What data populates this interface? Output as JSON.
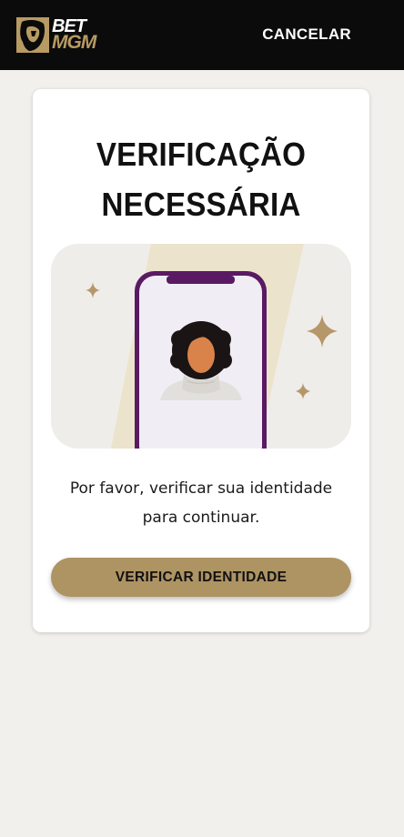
{
  "header": {
    "logo_line1": "BET",
    "logo_line2": "MGM",
    "cancel_label": "CANCELAR"
  },
  "card": {
    "title_line1": "VERIFICAÇÃO",
    "title_line2": "NECESSÁRIA",
    "message_line1": "Por favor, verificar sua identidade",
    "message_line2": "para continuar.",
    "button_label": "VERIFICAR IDENTIDADE"
  },
  "colors": {
    "header_bg": "#0b0b0b",
    "page_bg": "#f1f0ec",
    "accent_gold": "#ae9363",
    "phone_frame": "#5a1a63",
    "card_bg": "#ffffff"
  },
  "icons": [
    "bet-mgm-lion-logo-icon",
    "sparkle-icon",
    "phone-illustration",
    "person-avatar-illustration"
  ]
}
